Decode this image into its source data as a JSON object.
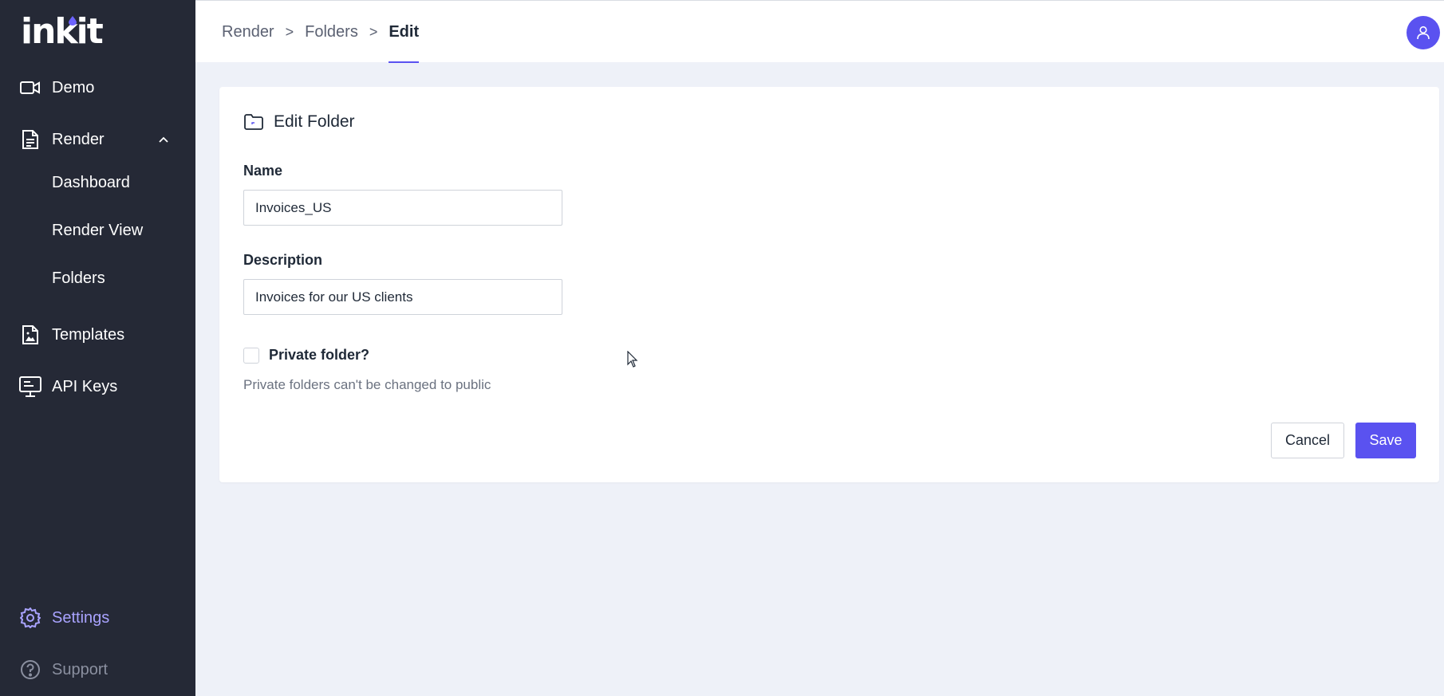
{
  "sidebar": {
    "logo": "inkit",
    "items": [
      {
        "label": "Demo",
        "icon": "video-camera-icon"
      },
      {
        "label": "Render",
        "icon": "document-icon",
        "expanded": true,
        "children": [
          {
            "label": "Dashboard"
          },
          {
            "label": "Render View"
          },
          {
            "label": "Folders"
          }
        ]
      },
      {
        "label": "Templates",
        "icon": "image-file-icon"
      },
      {
        "label": "API Keys",
        "icon": "monitor-icon"
      }
    ],
    "bottom": [
      {
        "label": "Settings",
        "icon": "gear-icon",
        "active": true
      },
      {
        "label": "Support",
        "icon": "help-circle-icon"
      }
    ],
    "colors": {
      "background": "#252936",
      "active": "#a9a3ff"
    }
  },
  "header": {
    "breadcrumb": [
      "Render",
      "Folders"
    ],
    "separator": ">",
    "current": "Edit",
    "avatar_icon": "user-icon"
  },
  "form": {
    "title": "Edit Folder",
    "title_icon": "folder-icon",
    "name_label": "Name",
    "name_value": "Invoices_US",
    "description_label": "Description",
    "description_value": "Invoices for our US clients",
    "private_label": "Private folder?",
    "private_checked": false,
    "private_help": "Private folders can't be changed to public",
    "cancel_label": "Cancel",
    "save_label": "Save"
  },
  "accent": "#5a52f0"
}
